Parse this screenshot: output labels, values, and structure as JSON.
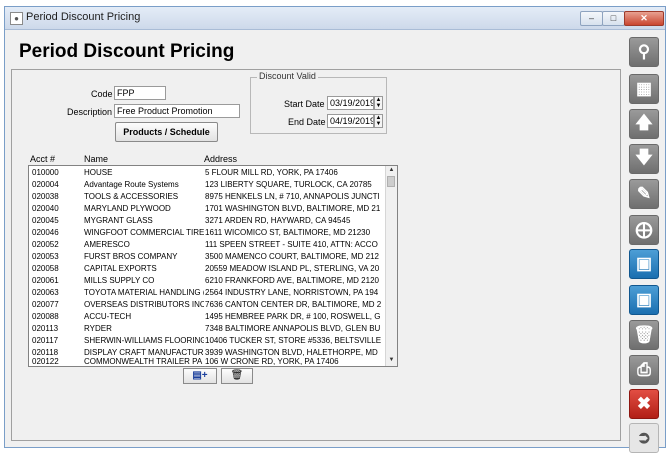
{
  "window": {
    "title": "Period Discount Pricing"
  },
  "page": {
    "heading": "Period Discount Pricing"
  },
  "form": {
    "code_label": "Code",
    "code_value": "FPP",
    "description_label": "Description",
    "description_value": "Free Product Promotion",
    "products_button": "Products / Schedule"
  },
  "discount_valid": {
    "legend": "Discount Valid",
    "start_label": "Start Date",
    "start_value": "03/19/2019",
    "end_label": "End Date",
    "end_value": "04/19/2019"
  },
  "accounts": {
    "columns": [
      "Acct #",
      "Name",
      "Address"
    ],
    "rows": [
      [
        "010000",
        "HOUSE",
        "5 FLOUR MILL RD, YORK, PA 17406"
      ],
      [
        "020004",
        "Advantage Route Systems",
        "123 LIBERTY SQUARE, TURLOCK, CA 20785"
      ],
      [
        "020038",
        "TOOLS & ACCESSORIES",
        "8975 HENKELS LN, # 710, ANNAPOLIS JUNCTI"
      ],
      [
        "020040",
        "MARYLAND PLYWOOD",
        "1701 WASHINGTON BLVD, BALTIMORE, MD 21"
      ],
      [
        "020045",
        "MYGRANT GLASS",
        "3271 ARDEN RD, HAYWARD, CA 94545"
      ],
      [
        "020046",
        "WINGFOOT COMMERCIAL TIRE",
        "1611 WICOMICO ST, BALTIMORE, MD 21230"
      ],
      [
        "020052",
        "AMERESCO",
        "111 SPEEN STREET - SUITE 410, ATTN: ACCO"
      ],
      [
        "020053",
        "FURST BROS COMPANY",
        "3500 MAMENCO COURT, BALTIMORE, MD 212"
      ],
      [
        "020058",
        "CAPITAL EXPORTS",
        "20559 MEADOW ISLAND PL, STERLING, VA 20"
      ],
      [
        "020061",
        "MILLS SUPPLY CO",
        "6210 FRANKFORD AVE, BALTIMORE, MD 2120"
      ],
      [
        "020063",
        "TOYOTA MATERIAL HANDLING (",
        "2564 INDUSTRY LANE, NORRISTOWN, PA 194"
      ],
      [
        "020077",
        "OVERSEAS DISTRIBUTORS INC",
        "7636 CANTON CENTER DR, BALTIMORE, MD 2"
      ],
      [
        "020088",
        "ACCU-TECH",
        "1495 HEMBREE PARK DR, # 100, ROSWELL, G"
      ],
      [
        "020113",
        "RYDER",
        "7348 BALTIMORE ANNAPOLIS BLVD, GLEN BU"
      ],
      [
        "020117",
        "SHERWIN-WILLIAMS FLOORING",
        "10406 TUCKER ST, STORE #5336, BELTSVILLE"
      ],
      [
        "020118",
        "DISPLAY CRAFT MANUFACTUR",
        "3939 WASHINGTON BLVD, HALETHORPE, MD"
      ],
      [
        "020122",
        "COMMONWEALTH TRAILER PA",
        "106 W CRONE RD, YORK, PA 17406"
      ]
    ]
  },
  "icons": {
    "toolbar": [
      "search-icon",
      "grid-icon",
      "arrow-up-icon",
      "arrow-down-icon",
      "pencil-icon",
      "copy-add-icon",
      "save-new-icon",
      "save-icon",
      "delete-icon",
      "print-icon",
      "close-icon",
      "exit-icon"
    ]
  },
  "colors": {
    "blue_button": "#1b6fb0",
    "red_button": "#b21f16",
    "gray_button": "#6f6f6f"
  }
}
